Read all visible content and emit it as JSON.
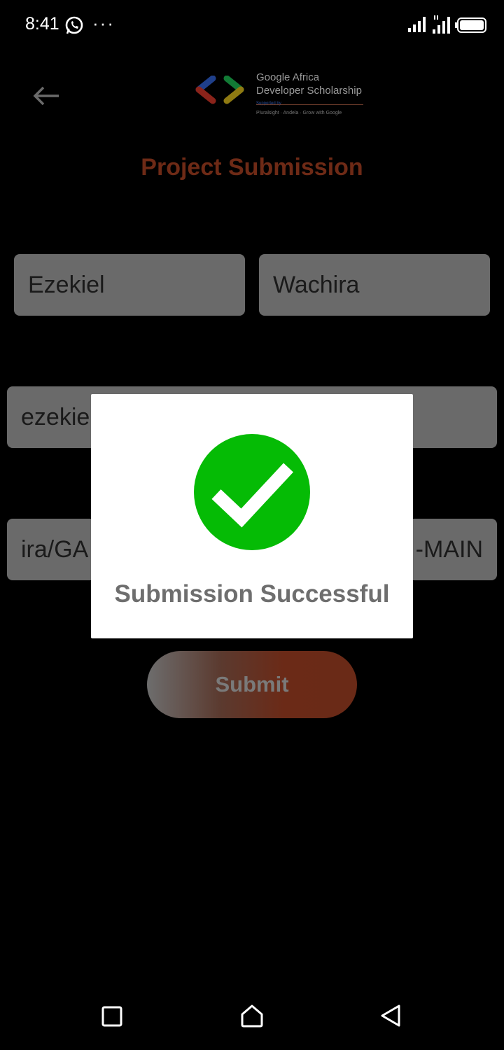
{
  "status_bar": {
    "time": "8:41",
    "more_indicator": "···",
    "icons": [
      "whatsapp-icon",
      "signal-icon",
      "signal-icon",
      "battery-icon"
    ]
  },
  "header": {
    "logo": {
      "line1": "Google Africa",
      "line2": "Developer Scholarship",
      "supported_by": "Supported by",
      "partners": "Pluralsight · Andela · Grow with Google"
    },
    "title": "Project Submission"
  },
  "form": {
    "first_name": "Ezekiel",
    "last_name": "Wachira",
    "email_visible": "ezekie",
    "link_left_visible": "ira/GA",
    "link_right_visible": "-MAIN",
    "submit_label": "Submit"
  },
  "dialog": {
    "icon": "check-circle-icon",
    "message": "Submission Successful"
  },
  "colors": {
    "title": "#6e2a16",
    "success_green": "#05bb05",
    "field_bg": "#6a6a6a"
  }
}
